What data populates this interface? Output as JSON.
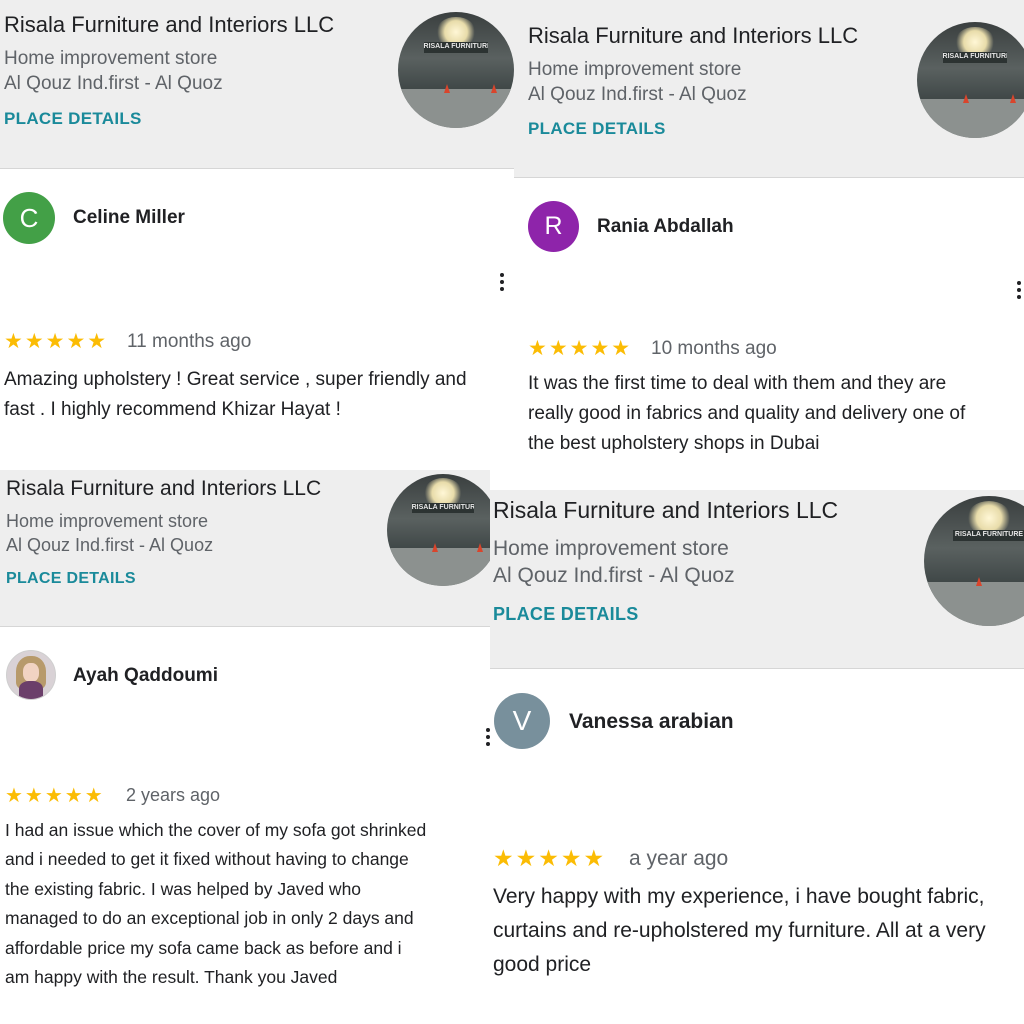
{
  "cards": [
    {
      "place": {
        "name": "Risala Furniture and Interiors LLC",
        "type": "Home improvement store",
        "address": "Al Qouz Ind.first - Al Quoz",
        "details_label": "PLACE DETAILS",
        "photo_sign": "RISALA FURNITURE"
      },
      "review": {
        "reviewer": "Celine Miller",
        "avatar_letter": "C",
        "avatar_color": "#43a047",
        "rating": 5,
        "stars": "★★★★★",
        "time_ago": "11 months ago",
        "lines": [
          "Amazing upholstery ! Great service , super friendly and",
          "fast . I highly recommend Khizar Hayat !"
        ]
      }
    },
    {
      "place": {
        "name": "Risala Furniture and Interiors LLC",
        "type": "Home improvement store",
        "address": "Al Qouz Ind.first - Al Quoz",
        "details_label": "PLACE DETAILS",
        "photo_sign": "RISALA FURNITURE"
      },
      "review": {
        "reviewer": "Rania Abdallah",
        "avatar_letter": "R",
        "avatar_color": "#8e24aa",
        "rating": 5,
        "stars": "★★★★★",
        "time_ago": "10 months ago",
        "lines": [
          "It was the first time to deal with them and they are",
          "really good in fabrics and quality and delivery one of",
          "the best upholstery shops in Dubai"
        ]
      }
    },
    {
      "place": {
        "name": "Risala Furniture and Interiors LLC",
        "type": "Home improvement store",
        "address": "Al Qouz Ind.first - Al Quoz",
        "details_label": "PLACE DETAILS",
        "photo_sign": "RISALA FURNITURE"
      },
      "review": {
        "reviewer": "Ayah Qaddoumi",
        "avatar_letter": "",
        "avatar_color": "#d9d2d6",
        "rating": 5,
        "stars": "★★★★★",
        "time_ago": "2 years ago",
        "lines": [
          "I had an issue which the cover of my sofa got shrinked",
          "and i needed to get it fixed without having to change",
          "the existing fabric. I was helped by Javed who",
          "managed to do an exceptional job in only 2 days and",
          "affordable price my sofa came back as before and i",
          "am happy with the result. Thank you Javed"
        ]
      }
    },
    {
      "place": {
        "name": "Risala Furniture and Interiors LLC",
        "type": "Home improvement store",
        "address": "Al Qouz Ind.first - Al Quoz",
        "details_label": "PLACE DETAILS",
        "photo_sign": "RISALA FURNITURE"
      },
      "review": {
        "reviewer": "Vanessa arabian",
        "avatar_letter": "V",
        "avatar_color": "#78909c",
        "rating": 5,
        "stars": "★★★★★",
        "time_ago": "a year ago",
        "lines": [
          "Very happy with my experience, i have bought fabric,",
          "curtains and re-upholstered my furniture. All at a very",
          "good price"
        ]
      }
    }
  ]
}
